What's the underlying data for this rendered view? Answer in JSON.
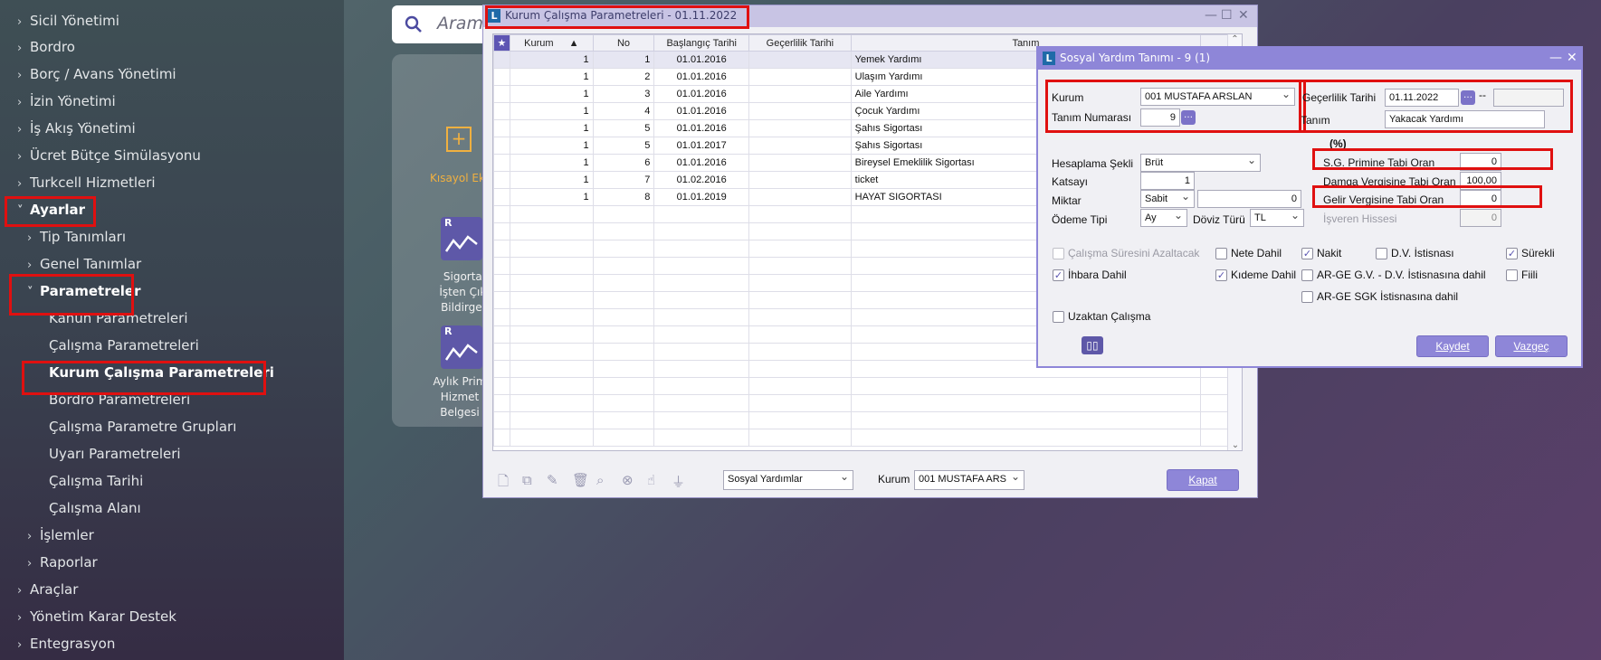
{
  "sidebar": {
    "items": [
      {
        "label": "Sicil Yönetimi"
      },
      {
        "label": "Bordro"
      },
      {
        "label": "Borç / Avans Yönetimi"
      },
      {
        "label": "İzin Yönetimi"
      },
      {
        "label": "İş Akış Yönetimi"
      },
      {
        "label": "Ücret Bütçe Simülasyonu"
      },
      {
        "label": "Turkcell Hizmetleri"
      },
      {
        "label": "Ayarlar"
      },
      {
        "label": "Tip Tanımları"
      },
      {
        "label": "Genel Tanımlar"
      },
      {
        "label": "Parametreler"
      },
      {
        "label": "Kanun Parametreleri"
      },
      {
        "label": "Çalışma Parametreleri"
      },
      {
        "label": "Kurum Çalışma Parametreleri"
      },
      {
        "label": "Bordro Parametreleri"
      },
      {
        "label": "Çalışma Parametre Grupları"
      },
      {
        "label": "Uyarı Parametreleri"
      },
      {
        "label": "Çalışma Tarihi"
      },
      {
        "label": "Çalışma Alanı"
      },
      {
        "label": "İşlemler"
      },
      {
        "label": "Raporlar"
      },
      {
        "label": "Araçlar"
      },
      {
        "label": "Yönetim Karar Destek"
      },
      {
        "label": "Entegrasyon"
      }
    ]
  },
  "search": {
    "placeholder": "Aramo"
  },
  "quick_panel": {
    "add_label": "Kısayol Ek",
    "tiles": [
      {
        "badge": "R",
        "text": "Sigortal\nİşten Çıkı\nBildirges"
      },
      {
        "badge": "R",
        "text": "Aylık Prim\nHizmet\nBelgesi"
      }
    ]
  },
  "main_window": {
    "title": "Kurum Çalışma Parametreleri - 01.11.2022",
    "columns": [
      "Kurum",
      "No",
      "Başlangıç Tarihi",
      "Geçerlilik Tarihi",
      "Tanım"
    ],
    "rows": [
      {
        "kurum": "1",
        "no": "1",
        "start": "01.01.2016",
        "valid": "",
        "tanim": "Yemek Yardımı"
      },
      {
        "kurum": "1",
        "no": "2",
        "start": "01.01.2016",
        "valid": "",
        "tanim": "Ulaşım Yardımı"
      },
      {
        "kurum": "1",
        "no": "3",
        "start": "01.01.2016",
        "valid": "",
        "tanim": "Aile Yardımı"
      },
      {
        "kurum": "1",
        "no": "4",
        "start": "01.01.2016",
        "valid": "",
        "tanim": "Çocuk Yardımı"
      },
      {
        "kurum": "1",
        "no": "5",
        "start": "01.01.2016",
        "valid": "",
        "tanim": "Şahıs Sigortası"
      },
      {
        "kurum": "1",
        "no": "5",
        "start": "01.01.2017",
        "valid": "",
        "tanim": "Şahıs Sigortası"
      },
      {
        "kurum": "1",
        "no": "6",
        "start": "01.01.2016",
        "valid": "",
        "tanim": "Bireysel Emeklilik Sigortası"
      },
      {
        "kurum": "1",
        "no": "7",
        "start": "01.02.2016",
        "valid": "",
        "tanim": "ticket"
      },
      {
        "kurum": "1",
        "no": "8",
        "start": "01.01.2019",
        "valid": "",
        "tanim": "HAYAT SIGORTASI"
      }
    ],
    "empty_rows": 14,
    "filter_select": "Sosyal Yardımlar",
    "kurum_label": "Kurum",
    "kurum_select": "001 MUSTAFA ARS",
    "close_button": "Kapat"
  },
  "dialog": {
    "title": "Sosyal Yardım Tanımı - 9 (1)",
    "kurum_label": "Kurum",
    "kurum_value": "001 MUSTAFA ARSLAN",
    "tanim_no_label": "Tanım Numarası",
    "tanim_no_value": "9",
    "gecerlilik_label": "Geçerlilik Tarihi",
    "gecerlilik_value": "01.11.2022",
    "gecerlilik_sep": "--",
    "tanim_label": "Tanım",
    "tanim_value": "Yakacak Yardımı",
    "percent_header": "(%)",
    "hesaplama_label": "Hesaplama Şekli",
    "hesaplama_value": "Brüt",
    "katsayi_label": "Katsayı",
    "katsayi_value": "1",
    "miktar_label": "Miktar",
    "miktar_type": "Sabit",
    "miktar_value": "0",
    "odeme_label": "Ödeme Tipi",
    "odeme_value": "Ay",
    "doviz_label": "Döviz Türü",
    "doviz_value": "TL",
    "sg_label": "S.G. Primine Tabi Oran",
    "sg_value": "0",
    "damga_label": "Damga Vergisine Tabi Oran",
    "damga_value": "100,00",
    "gelir_label": "Gelir Vergisine Tabi Oran",
    "gelir_value": "0",
    "isveren_label": "İşveren Hissesi",
    "isveren_value": "0",
    "checkboxes": {
      "calisma_suresi": "Çalışma Süresini Azaltacak",
      "nete_dahil": "Nete Dahil",
      "nakit": "Nakit",
      "dv_istisnasi": "D.V. İstisnası",
      "surekli": "Sürekli",
      "ihbara_dahil": "İhbara Dahil",
      "kideme_dahil": "Kıdeme Dahil",
      "arge_gv": "AR-GE G.V. - D.V. İstisnasına dahil",
      "fiili": "Fiili",
      "arge_sgk": "AR-GE SGK İstisnasına dahil",
      "uzaktan": "Uzaktan Çalışma"
    },
    "save_button": "Kaydet",
    "cancel_button": "Vazgeç"
  },
  "colors": {
    "highlight": "#e01010",
    "accent": "#8e86d8",
    "titlebar": "#c8c4e4"
  }
}
